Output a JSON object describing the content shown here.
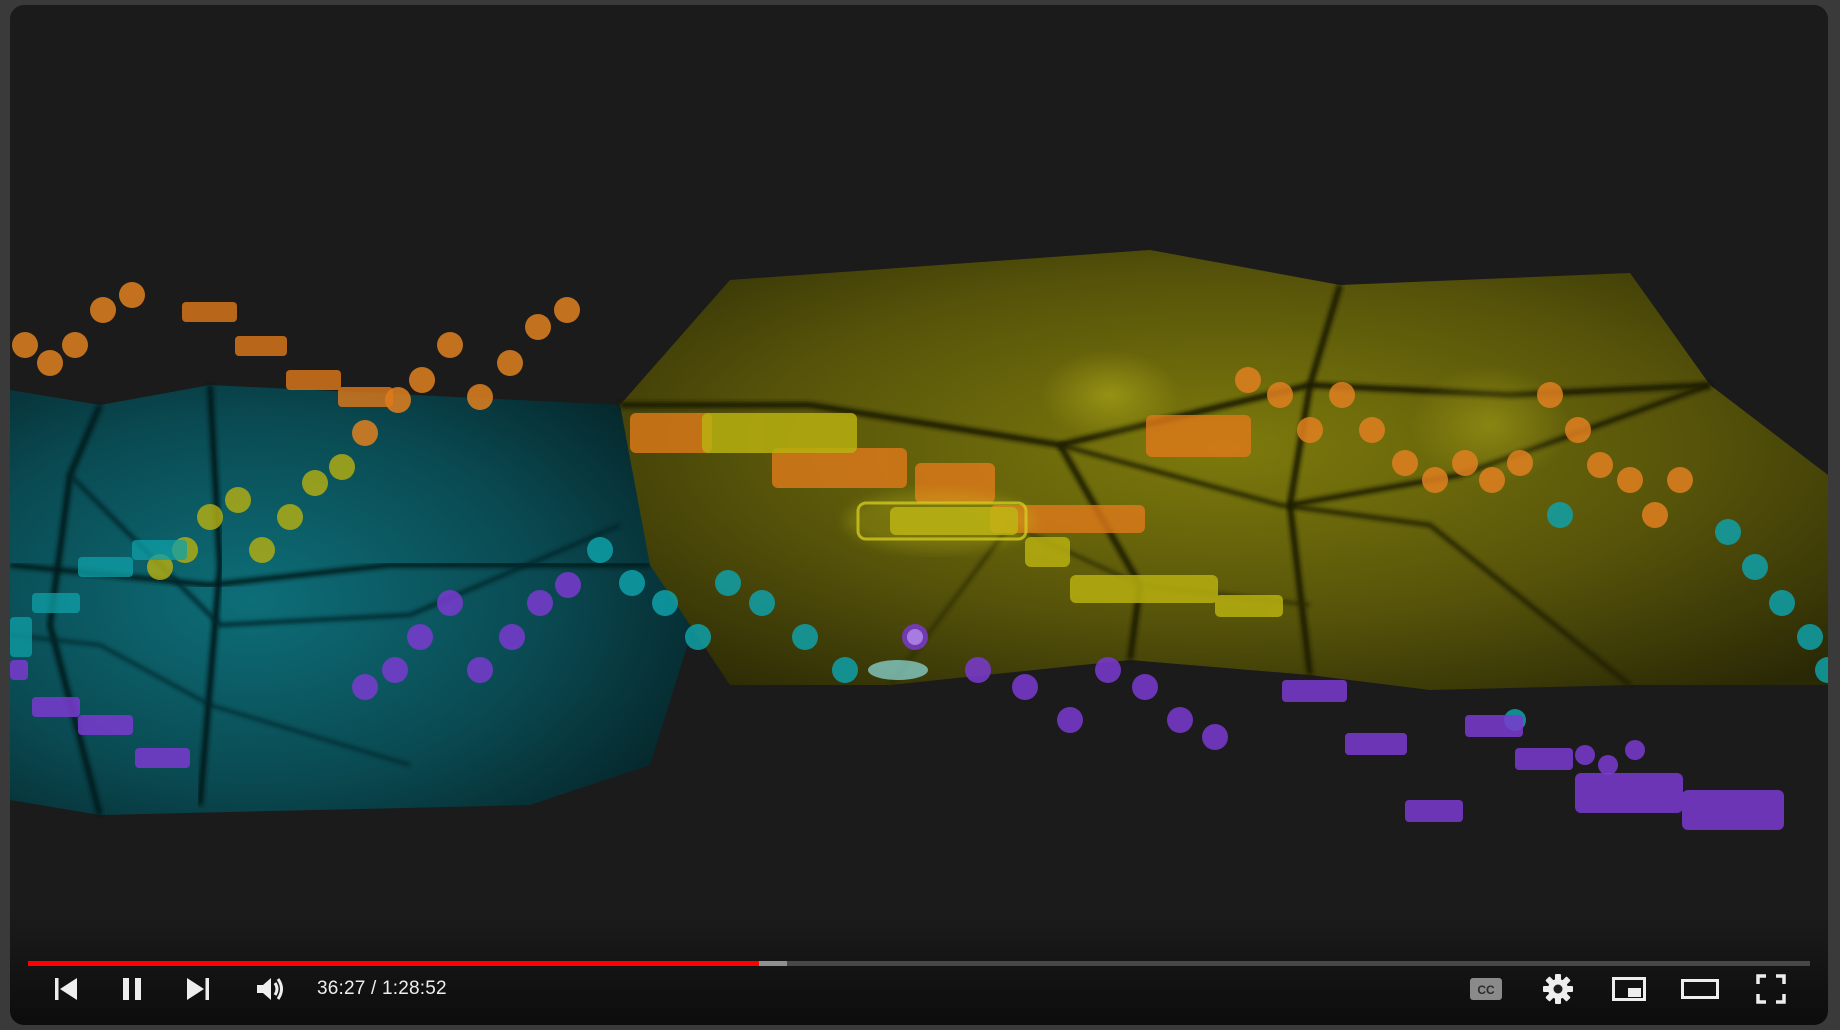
{
  "player": {
    "time_current": "36:27",
    "time_separator": " / ",
    "time_duration": "1:28:52",
    "progress_played_fraction": 0.41,
    "progress_buffered_fraction": 0.426,
    "progress_color": "#ff0000",
    "buttons": {
      "previous": "previous-icon",
      "pause": "pause-icon",
      "next": "next-icon",
      "volume": "volume-icon",
      "captions": "cc-icon",
      "captions_label": "CC",
      "settings": "gear-icon",
      "miniplayer": "miniplayer-icon",
      "theater": "theater-icon",
      "fullscreen": "fullscreen-icon"
    }
  },
  "video": {
    "colors": {
      "orange": "#e07a1a",
      "yellow": "#b8b010",
      "teal": "#0fa0a8",
      "purple": "#7a3ad0",
      "teal_surface": "#0a4e56",
      "yellow_surface": "#5e5a08"
    }
  }
}
